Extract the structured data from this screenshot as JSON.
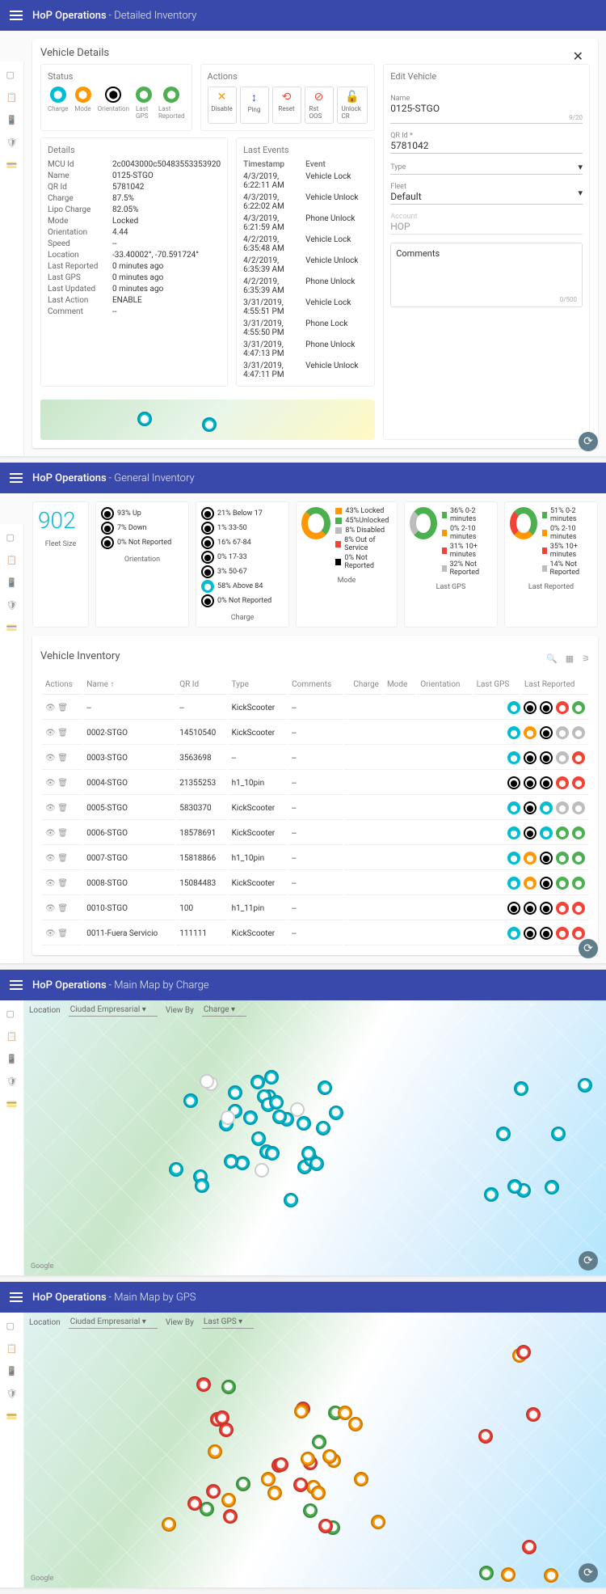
{
  "panels": {
    "detail": {
      "title": "HoP Operations",
      "sub": "- Detailed Inventory"
    },
    "general": {
      "title": "HoP Operations",
      "sub": "- General Inventory"
    },
    "map1": {
      "title": "HoP Operations",
      "sub": "- Main Map by Charge"
    },
    "map2": {
      "title": "HoP Operations",
      "sub": "- Main Map by GPS"
    }
  },
  "vehicle": {
    "title": "Vehicle Details",
    "status_title": "Status",
    "status": [
      {
        "label": "Charge"
      },
      {
        "label": "Mode"
      },
      {
        "label": "Orientation"
      },
      {
        "label": "Last GPS"
      },
      {
        "label": "Last Reported"
      }
    ],
    "actions_title": "Actions",
    "actions": [
      {
        "label": "Disable",
        "icon": "✕",
        "color": "#ff9800"
      },
      {
        "label": "Ping",
        "icon": "↕",
        "color": "#3949ab"
      },
      {
        "label": "Reset",
        "icon": "⟲",
        "color": "#f44336"
      },
      {
        "label": "Rst OOS",
        "icon": "⊘",
        "color": "#f44336"
      },
      {
        "label": "Unlock CR",
        "icon": "🔓",
        "color": "#4caf50"
      }
    ],
    "details_title": "Details",
    "details": [
      {
        "k": "MCU Id",
        "v": "2c0043000c50483553353920"
      },
      {
        "k": "Name",
        "v": "0125-STGO"
      },
      {
        "k": "QR Id",
        "v": "5781042"
      },
      {
        "k": "Charge",
        "v": "87.5%"
      },
      {
        "k": "Lipo Charge",
        "v": "82.05%"
      },
      {
        "k": "Mode",
        "v": "Locked"
      },
      {
        "k": "Orientation",
        "v": "4.44"
      },
      {
        "k": "Speed",
        "v": "--"
      },
      {
        "k": "Location",
        "v": "-33.40002°, -70.591724°"
      },
      {
        "k": "Last Reported",
        "v": "0 minutes ago"
      },
      {
        "k": "Last GPS",
        "v": "0 minutes ago"
      },
      {
        "k": "Last Updated",
        "v": "0 minutes ago"
      },
      {
        "k": "Last Action",
        "v": "ENABLE"
      },
      {
        "k": "Comment",
        "v": "--"
      }
    ],
    "events_title": "Last Events",
    "events_headers": {
      "ts": "Timestamp",
      "ev": "Event"
    },
    "events": [
      {
        "ts": "4/3/2019, 6:22:11 AM",
        "ev": "Vehicle Lock"
      },
      {
        "ts": "4/3/2019, 6:22:02 AM",
        "ev": "Vehicle Unlock"
      },
      {
        "ts": "4/3/2019, 6:21:59 AM",
        "ev": "Phone Unlock"
      },
      {
        "ts": "4/2/2019, 6:35:48 AM",
        "ev": "Vehicle Lock"
      },
      {
        "ts": "4/2/2019, 6:35:39 AM",
        "ev": "Vehicle Unlock"
      },
      {
        "ts": "4/2/2019, 6:35:39 AM",
        "ev": "Phone Unlock"
      },
      {
        "ts": "3/31/2019, 4:55:51 PM",
        "ev": "Vehicle Lock"
      },
      {
        "ts": "3/31/2019, 4:55:50 PM",
        "ev": "Phone Lock"
      },
      {
        "ts": "3/31/2019, 4:47:13 PM",
        "ev": "Phone Unlock"
      },
      {
        "ts": "3/31/2019, 4:47:11 PM",
        "ev": "Vehicle Unlock"
      }
    ],
    "edit": {
      "title": "Edit Vehicle",
      "name_label": "Name",
      "name_val": "0125-STGO",
      "name_count": "9/20",
      "qr_label": "QR Id *",
      "qr_val": "5781042",
      "type_label": "Type",
      "fleet_label": "Fleet",
      "fleet_val": "Default",
      "account_label": "Account",
      "account_val": "HOP",
      "comments_label": "Comments",
      "comments_count": "0/500"
    }
  },
  "general": {
    "fleet_size": "902",
    "fleet_label": "Fleet Size",
    "orientation": {
      "title": "Orientation",
      "items": [
        {
          "pct": "93% Up"
        },
        {
          "pct": "7% Down"
        },
        {
          "pct": "0% Not Reported"
        }
      ]
    },
    "charge": {
      "title": "Charge",
      "items": [
        {
          "pct": "21% Below 17"
        },
        {
          "pct": "1% 33-50"
        },
        {
          "pct": "16% 67-84"
        },
        {
          "pct": "0% 17-33"
        },
        {
          "pct": "3% 50-67"
        },
        {
          "pct": "58% Above 84"
        },
        {
          "pct": "0% Not Reported"
        }
      ]
    },
    "mode": {
      "title": "Mode",
      "items": [
        {
          "c": "#ff9800",
          "t": "43%  Locked"
        },
        {
          "c": "#4caf50",
          "t": "45%Unlocked"
        },
        {
          "c": "#bdbdbd",
          "t": "8%  Disabled"
        },
        {
          "c": "#f44336",
          "t": "8%  Out of Service"
        },
        {
          "c": "#000",
          "t": "0%  Not Reported"
        }
      ]
    },
    "gps": {
      "title": "Last GPS",
      "items": [
        {
          "c": "#4caf50",
          "t": "36%  0-2 minutes"
        },
        {
          "c": "#ff9800",
          "t": "0%  2-10 minutes"
        },
        {
          "c": "#f44336",
          "t": "31%  10+ minutes"
        },
        {
          "c": "#bdbdbd",
          "t": "32%  Not Reported"
        }
      ]
    },
    "reported": {
      "title": "Last Reported",
      "items": [
        {
          "c": "#4caf50",
          "t": "51%  0-2 minutes"
        },
        {
          "c": "#ff9800",
          "t": "0%  2-10 minutes"
        },
        {
          "c": "#f44336",
          "t": "35%  10+ minutes"
        },
        {
          "c": "#bdbdbd",
          "t": "14%  Not Reported"
        }
      ]
    },
    "inventory_title": "Vehicle Inventory",
    "cols": {
      "actions": "Actions",
      "name": "Name ↑",
      "qr": "QR Id",
      "type": "Type",
      "comments": "Comments",
      "charge": "Charge",
      "mode": "Mode",
      "orient": "Orientation",
      "gps": "Last GPS",
      "rep": "Last Reported"
    },
    "rows": [
      {
        "name": "--",
        "qr": "--",
        "type": "KickScooter",
        "c": "--",
        "b": [
          "teal",
          "black",
          "black",
          "red",
          "green"
        ]
      },
      {
        "name": "0002-STGO",
        "qr": "14510540",
        "type": "KickScooter",
        "c": "--",
        "b": [
          "teal",
          "orange",
          "black",
          "grey",
          "grey"
        ]
      },
      {
        "name": "0003-STGO",
        "qr": "3563698",
        "type": "--",
        "c": "--",
        "b": [
          "teal",
          "black",
          "black",
          "grey",
          "red"
        ]
      },
      {
        "name": "0004-STGO",
        "qr": "21355253",
        "type": "h1_10pin",
        "c": "--",
        "b": [
          "black",
          "black",
          "black",
          "red",
          "red"
        ]
      },
      {
        "name": "0005-STGO",
        "qr": "5830370",
        "type": "KickScooter",
        "c": "--",
        "b": [
          "teal",
          "black",
          "teal",
          "grey",
          "grey"
        ]
      },
      {
        "name": "0006-STGO",
        "qr": "18578691",
        "type": "KickScooter",
        "c": "--",
        "b": [
          "teal",
          "black",
          "teal",
          "green",
          "green"
        ]
      },
      {
        "name": "0007-STGO",
        "qr": "15818866",
        "type": "h1_10pin",
        "c": "--",
        "b": [
          "teal",
          "orange",
          "black",
          "green",
          "green"
        ]
      },
      {
        "name": "0008-STGO",
        "qr": "15084483",
        "type": "KickScooter",
        "c": "--",
        "b": [
          "teal",
          "orange",
          "black",
          "green",
          "green"
        ]
      },
      {
        "name": "0010-STGO",
        "qr": "100",
        "type": "h1_11pin",
        "c": "--",
        "b": [
          "black",
          "black",
          "black",
          "red",
          "red"
        ]
      },
      {
        "name": "0011-Fuera Servicio",
        "qr": "111111",
        "type": "KickScooter",
        "c": "--",
        "b": [
          "teal",
          "black",
          "black",
          "red",
          "red"
        ]
      }
    ]
  },
  "mapctrl": {
    "loc_label": "Location",
    "loc_val": "Ciudad Empresarial",
    "view_label": "View By",
    "view1": "Charge",
    "view2": "Last GPS"
  }
}
